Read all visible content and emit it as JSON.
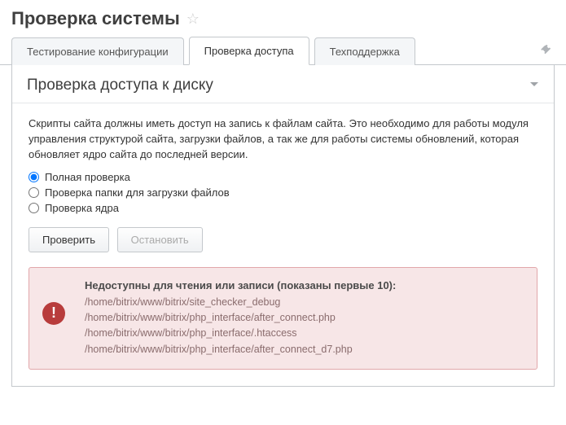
{
  "header": {
    "title": "Проверка системы"
  },
  "tabs": [
    {
      "label": "Тестирование конфигурации",
      "active": false
    },
    {
      "label": "Проверка доступа",
      "active": true
    },
    {
      "label": "Техподдержка",
      "active": false
    }
  ],
  "panel": {
    "title": "Проверка доступа к диску",
    "description": "Скрипты сайта должны иметь доступ на запись к файлам сайта. Это необходимо для работы модуля управления структурой сайта, загрузки файлов, а так же для работы системы обновлений, которая обновляет ядро сайта до последней версии.",
    "radios": [
      {
        "label": "Полная проверка",
        "checked": true
      },
      {
        "label": "Проверка папки для загрузки файлов",
        "checked": false
      },
      {
        "label": "Проверка ядра",
        "checked": false
      }
    ],
    "buttons": {
      "check": "Проверить",
      "stop": "Остановить"
    }
  },
  "error": {
    "title": "Недоступны для чтения или записи (показаны первые 10):",
    "files": [
      "/home/bitrix/www/bitrix/site_checker_debug",
      "/home/bitrix/www/bitrix/php_interface/after_connect.php",
      "/home/bitrix/www/bitrix/php_interface/.htaccess",
      "/home/bitrix/www/bitrix/php_interface/after_connect_d7.php"
    ]
  }
}
